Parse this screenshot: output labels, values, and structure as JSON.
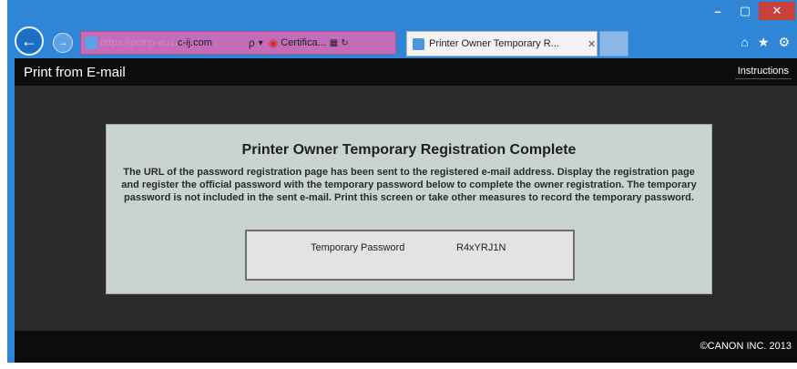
{
  "window": {
    "controls": {
      "minimize": "–",
      "maximize": "▢",
      "close": "✕"
    }
  },
  "toolbar": {
    "back_icon": "back-arrow-icon",
    "forward_icon": "forward-arrow-icon",
    "address": {
      "url_faint": "https://pcmp-eu1.",
      "url_bold": "c-ij.com",
      "search_glyph": "ρ",
      "dropdown_glyph": "▾",
      "certificate_label": "Certifica...",
      "lock_glyph": "🔒",
      "refresh_glyph": "↻"
    },
    "tab": {
      "label": "Printer Owner Temporary R...",
      "close": "✕"
    },
    "right_icons": [
      "home-icon",
      "star-icon",
      "gear-icon"
    ]
  },
  "page": {
    "header_title": "Print from E-mail",
    "instructions_label": "Instructions",
    "panel_title": "Printer Owner Temporary Registration Complete",
    "panel_text": "The URL of the password registration page has been sent to the registered e-mail address. Display the registration page and register the official password with the temporary password below to complete the owner registration. The temporary password is not included in the sent e-mail. Print this screen or take other measures to record the temporary password.",
    "password_label": "Temporary Password",
    "password_value": "R4xYRJ1N",
    "copyright": "©CANON INC. 2013"
  },
  "colors": {
    "titlebar": "#2f86d6",
    "address_highlight": "#c46cb8",
    "page_background": "#2b2b2b",
    "header_footer": "#0c0c0c",
    "panel": "#c8d3d2"
  }
}
